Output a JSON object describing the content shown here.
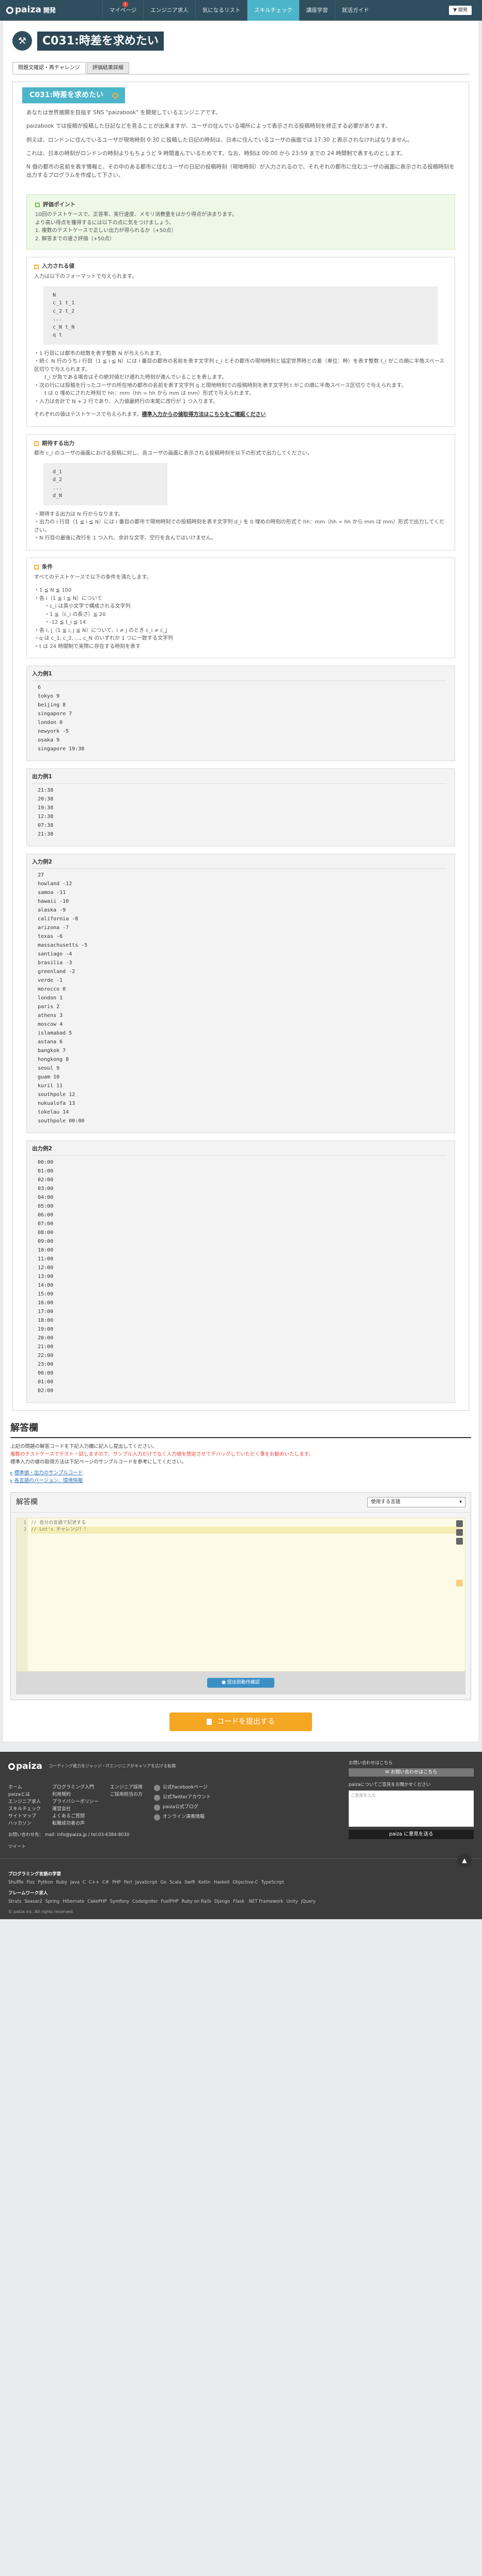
{
  "header": {
    "logo": "paiza",
    "logo_sub": "開発",
    "nav": [
      {
        "label": "マイページ",
        "badge": "1"
      },
      {
        "label": "エンジニア求人"
      },
      {
        "label": "気になるリスト"
      },
      {
        "label": "スキルチェック",
        "active": true
      },
      {
        "label": "講座学習"
      },
      {
        "label": "就活ガイド"
      }
    ],
    "right_button": "▼ 開発"
  },
  "page": {
    "title": "C031:時差を求めたい",
    "tabs": [
      "問題文確認・再チャレンジ",
      "評価結果詳細"
    ]
  },
  "problem": {
    "heading": "C031:時差を求めたい",
    "intro": [
      "あなたは世界展開を目指す SNS \"paizabook\" を開発しているエンジニアです。",
      "paizabook では投稿が投稿した日記などを見ることが出来ますが、ユーザの住んでいる場所によって表示される投稿時刻を修正する必要があります。",
      "例えば、ロンドンに住んでいるユーザが現地時刻 0:30 に投稿した日記の時刻は、日本に住んでいるユーザの画面では 17:30 と表示されなければなりません。",
      "これは、日本の時刻がロンドンの時刻よりもちょうど 9 時間進んでいるためです。なお、時刻は 00:00 から 23:59 までの 24 時間制で表すものとします。",
      "N 個の都市の名前を表す情報と、その中のある都市に住むユーザの日記の投稿時刻（現地時刻）が入力されるので、それぞれの都市に住むユーザの画面に表示される投稿時刻を出力するプログラムを作成して下さい。"
    ],
    "evaluation": {
      "heading": "評価ポイント",
      "lines": [
        "10回のテストケースで、正答率、実行速度、メモリ消費量をはかり得点が決まります。",
        "より高い得点を獲得するには以下の点に気をつけましょう。",
        "1. 複数のテストケースで正しい出力が得られるか（+50点）",
        "2. 解答までの速さ評価（+50点）"
      ]
    },
    "input_format": {
      "heading": "入力される値",
      "lead": "入力は以下のフォーマットで与えられます。",
      "format": [
        "N",
        "c_1 t_1",
        "c_2 t_2",
        "...",
        "c_N t_N",
        "q t"
      ],
      "notes": [
        "・1 行目には都市の総数を表す整数 N が与えられます。",
        "・続く N 行のうち i 行目（1 ≦ i ≦ N）には i 番目の都市の名前を表す文字列 c_i とその都市の現地時刻と協定世界時との差（単位：時）を表す整数 t_i がこの順に半角スペース区切りで与えられます。",
        "  t_i が負である場合はその絶対値だけ遅れた時刻が進んでいることを表します。",
        "・次の行には投稿を行ったユーザの所在地の都市の名前を表す文字列 q と現地時刻での投稿時刻を表す文字列 t がこの順に半角スペース区切りで与えられます。",
        "  t は 0 埋めにされた時刻で hh：mm（hh = hh から mm は mm）形式で与えられます。",
        "・入力は合計で N + 2 行であり、入力値最終行の末尾に改行が 1 つ入ります。"
      ],
      "link_lead": "それぞれの値はテストケースで与えられます。",
      "link": "標準入力からの値取得方法はこちらをご確認ください"
    },
    "output_format": {
      "heading": "期待する出力",
      "lead": "都市 c_i のユーザの画面における投稿に対し、各ユーザの画面に表示される投稿時刻を以下の形式で出力してください。",
      "format": [
        "d_1",
        "d_2",
        "...",
        "d_N"
      ],
      "notes": [
        "・期待する出力は N 行からなります。",
        "・出力の i 行目（1 ≦ i ≦ N）には i 番目の都市で現地時刻での投稿時刻を表す文字列 d_i を 0 埋めの時刻の形式で hh：mm（hh = hh から mm は mm）形式で出力してください。",
        "・N 行目の最後に改行を 1 つ入れ、余計な文字、空行を含んではいけません。"
      ]
    },
    "conditions": {
      "heading": "条件",
      "lead": "すべてのテストケースで以下の条件を満たします。",
      "lines": [
        "・1 ≦ N ≦ 100",
        "・各 i（1 ≦ i ≦ N）について",
        "  ・c_i は英小文字で構成される文字列",
        "  ・1 ≦（c_i の長さ）≦ 20",
        "  ・-12 ≦ t_i ≦ 14",
        "・各 i, j（1 ≦ i, j ≦ N）について、i ≠ j のとき c_i ≠ c_j",
        "・q は c_1, c_2, ..., c_N のいずれか 1 つに一致する文字列",
        "・t は 24 時間制で実際に存在する時刻を表す"
      ]
    },
    "examples": [
      {
        "heading": "入力例1",
        "lines": [
          "6",
          "tokyo 9",
          "beijing 8",
          "singapore 7",
          "london 0",
          "newyork -5",
          "osaka 9",
          "singapore 19:38"
        ]
      },
      {
        "heading": "出力例1",
        "lines": [
          "21:38",
          "20:38",
          "19:38",
          "12:38",
          "07:38",
          "21:38"
        ]
      },
      {
        "heading": "入力例2",
        "lines": [
          "27",
          "howland -12",
          "samoa -11",
          "hawaii -10",
          "alaska -9",
          "california -8",
          "arizona -7",
          "texas -6",
          "massachusetts -5",
          "santiago -4",
          "brasilia -3",
          "greenland -2",
          "verde -1",
          "morocco 0",
          "london 1",
          "paris 2",
          "athens 3",
          "moscow 4",
          "islamabad 5",
          "astana 6",
          "bangkok 7",
          "hongkong 8",
          "seoul 9",
          "guam 10",
          "kuril 11",
          "southpole 12",
          "nukualofa 13",
          "tokelau 14",
          "southpole 00:00"
        ]
      },
      {
        "heading": "出力例2",
        "lines": [
          "00:00",
          "01:00",
          "02:00",
          "03:00",
          "04:00",
          "05:00",
          "06:00",
          "07:00",
          "08:00",
          "09:00",
          "10:00",
          "11:00",
          "12:00",
          "13:00",
          "14:00",
          "15:00",
          "16:00",
          "17:00",
          "18:00",
          "19:00",
          "20:00",
          "21:00",
          "22:00",
          "23:00",
          "00:00",
          "01:00",
          "02:00"
        ]
      }
    ]
  },
  "answer": {
    "title": "解答欄",
    "desc1": "上記の問題の解答コードを下記入力欄に記入し提出してください。",
    "desc2": "複数のテストケースでテスト・試しますので、サンプル入力だけでなく入力値を想定させてデバッグしていただく事をお勧めいたします。",
    "desc3": "標準入力の値の取得方法は下記ページのサンプルコードを参考にしてください。",
    "links": [
      "標準値・出力のサンプルコード",
      "各言語のバージョン、環境情報"
    ],
    "editor_label": "解答欄",
    "language": "使用する言語",
    "code_lines": [
      "// 自分の言語で記述する",
      "// Let's チャレンジ！！"
    ],
    "run_button": "提出前動作確認",
    "submit_button": "コードを提出する"
  },
  "footer": {
    "logo": "paiza",
    "tagline": "コーディング能力をジャッジ・ITエンジニアがキャリアを広げる転職",
    "col1": [
      "ホーム",
      "paizaとは",
      "エンジニア求人",
      "スキルチェック",
      "サイトマップ",
      "ハッカソン"
    ],
    "col2": [
      "プログラミング入門",
      "利用規約",
      "プライバシーポリシー",
      "運営会社",
      "よくあるご質問",
      "転職成功者の声"
    ],
    "col3": [
      "エンジニア採用",
      "ご採用担当の方"
    ],
    "social": [
      "公式Facebookページ",
      "公式Twitterアカウント",
      "paiza公式ブログ",
      "オンライン演奏情報"
    ],
    "right_label": "お問い合わせはこちら",
    "right_button": "お問い合わせはこちら",
    "feedback_label": "paizaについてご意見をお聞かせください",
    "feedback_placeholder": "ご意見を入力",
    "feedback_button": "paiza に意見を送る",
    "contact": "お問い合わせ先： mail: info@paiza.jp / tel:03-6384-8030",
    "tweet": "ツイート",
    "kw_head1": "プログラミング言語の学習",
    "kw1": [
      "Shuffle",
      "Fizz",
      "Python",
      "Ruby",
      "Java",
      "C",
      "C++",
      "C#",
      "PHP",
      "Perl",
      "JavaScript",
      "Go",
      "Scala",
      "Swift",
      "Kotlin",
      "Haskell",
      "Objective-C",
      "TypeScript"
    ],
    "kw_head2": "フレームワーク求人",
    "kw2": [
      "Struts",
      "Seasar2",
      "Spring",
      "Hibernate",
      "CakePHP",
      "Symfony",
      "CodeIgniter",
      "FuelPHP",
      "Ruby on Rails",
      "Django",
      "Flask",
      ".NET Framework",
      "Unity",
      "jQuery"
    ],
    "copyright": "© paiza inc. All rights reserved."
  }
}
